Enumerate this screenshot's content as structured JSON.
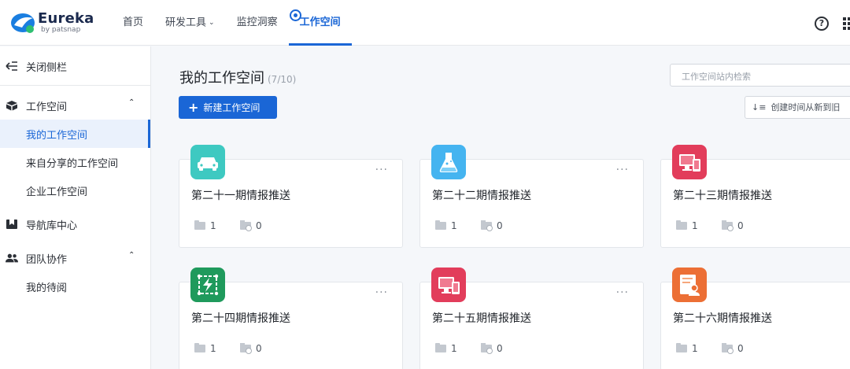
{
  "app": {
    "name": "Eureka",
    "sub": "by patsnap"
  },
  "nav": {
    "items": [
      {
        "label": "首页"
      },
      {
        "label": "研发工具"
      },
      {
        "label": "监控洞察"
      },
      {
        "label": "工作空间"
      }
    ],
    "active": "工作空间"
  },
  "header": {
    "help": "?"
  },
  "sidebar": {
    "collapse_label": "关闭侧栏",
    "workspace": {
      "label": "工作空间",
      "expanded": true
    },
    "workspace_items": [
      {
        "label": "我的工作空间",
        "active": true
      },
      {
        "label": "来自分享的工作空间"
      },
      {
        "label": "企业工作空间"
      }
    ],
    "nav_lib": {
      "label": "导航库中心"
    },
    "team": {
      "label": "团队协作",
      "expanded": true
    },
    "team_items": [
      {
        "label": "我的待阅"
      }
    ]
  },
  "main": {
    "title": "我的工作空间",
    "count": "(7/10)",
    "search_placeholder": "工作空间站内检索",
    "new_button": "新建工作空间",
    "sort_label": "创建时间从新到旧",
    "more_label": "···",
    "cards": [
      {
        "title": "第二十一期情报推送",
        "folders": "1",
        "shared": "0",
        "icon": "car-icon",
        "color": "#3ec9c1"
      },
      {
        "title": "第二十二期情报推送",
        "folders": "1",
        "shared": "0",
        "icon": "flask-icon",
        "color": "#45b4f0"
      },
      {
        "title": "第二十三期情报推送",
        "folders": "1",
        "shared": "0",
        "icon": "devices-icon",
        "color": "#e23d5b"
      },
      {
        "title": "第二十四期情报推送",
        "folders": "1",
        "shared": "0",
        "icon": "circuit-icon",
        "color": "#1f9a5c"
      },
      {
        "title": "第二十五期情报推送",
        "folders": "1",
        "shared": "0",
        "icon": "devices-icon",
        "color": "#e23d5b"
      },
      {
        "title": "第二十六期情报推送",
        "folders": "1",
        "shared": "0",
        "icon": "document-person-icon",
        "color": "#ec6f35"
      }
    ]
  },
  "colors": {
    "accent": "#1a66d6"
  }
}
